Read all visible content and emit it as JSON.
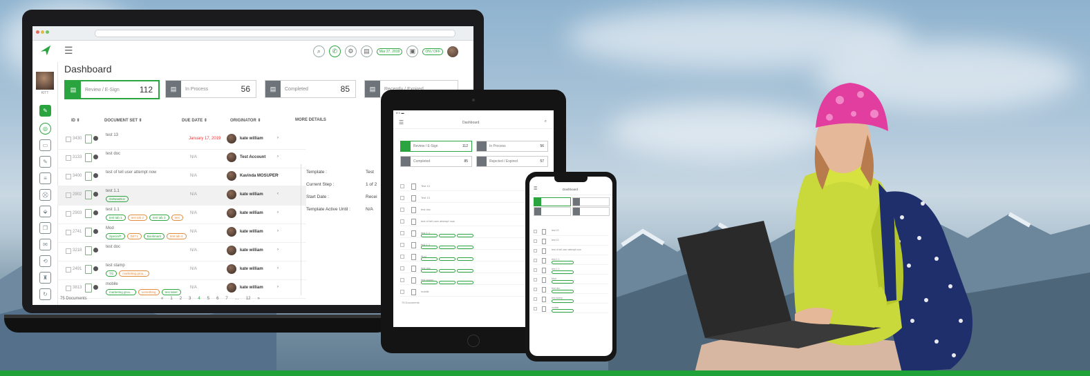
{
  "laptop_app": {
    "title": "Dashboard",
    "side_user_caption": "KITT",
    "top_pills": [
      "Mar 27, 2019",
      "ON / OFF"
    ],
    "cards": [
      {
        "label": "Review / E-Sign",
        "count": "112",
        "active": true
      },
      {
        "label": "In Process",
        "count": "56",
        "active": false
      },
      {
        "label": "Completed",
        "count": "85",
        "active": false
      },
      {
        "label": "Recently / Expired",
        "count": "",
        "active": false
      }
    ],
    "columns": {
      "id": "ID ⇕",
      "document_set": "DOCUMENT SET ⇕",
      "due_date": "DUE DATE ⇕",
      "originator": "ORIGINATOR ⇕",
      "more_details": "MORE DETAILS"
    },
    "rows": [
      {
        "id": "3430",
        "name": "test 13",
        "tags": [],
        "due": "January 17, 2019",
        "due_red": true,
        "originator": "kate william",
        "chev": "›"
      },
      {
        "id": "3133",
        "name": "test doc",
        "tags": [],
        "due": "N/A",
        "due_red": false,
        "originator": "Test Account",
        "chev": "›"
      },
      {
        "id": "3400",
        "name": "test of tell user attempt now",
        "tags": [],
        "due": "N/A",
        "due_red": false,
        "originator": "Kavinda MOSUPER",
        "chev": "›"
      },
      {
        "id": "2902",
        "name": "test 1.1",
        "tags": [
          "GeNewDoc"
        ],
        "due": "N/A",
        "due_red": false,
        "originator": "kate william",
        "chev": "‹"
      },
      {
        "id": "2903",
        "name": "test 1.1",
        "tags": [
          "test tab 1",
          "test tab 2",
          "test tab 3",
          "test"
        ],
        "due": "N/A",
        "due_red": false,
        "originator": "kate william",
        "chev": "›"
      },
      {
        "id": "2741",
        "name": "Mod",
        "tags": [
          "SpecialT",
          "SET1",
          "Bookmark",
          "test tab 4"
        ],
        "due": "N/A",
        "due_red": false,
        "originator": "kate william",
        "chev": "›"
      },
      {
        "id": "3218",
        "name": "test doc",
        "tags": [],
        "due": "N/A",
        "due_red": false,
        "originator": "kate william",
        "chev": "›"
      },
      {
        "id": "2491",
        "name": "test stamp",
        "tags": [
          "TG",
          "marketing grou..."
        ],
        "due": "N/A",
        "due_red": false,
        "originator": "kate william",
        "chev": "›"
      },
      {
        "id": "3813",
        "name": "mobile",
        "tags": [
          "marketing grou...",
          "something",
          "test label"
        ],
        "due": "N/A",
        "due_red": false,
        "originator": "kate william",
        "chev": "›"
      }
    ],
    "details": {
      "template_label": "Template :",
      "template_value": "Test",
      "current_step_label": "Current Step :",
      "current_step_value": "1 of 2",
      "start_date_label": "Start Date :",
      "start_date_value": "Recei",
      "active_until_label": "Template Active Until :",
      "active_until_value": "N/A"
    },
    "pager": {
      "records": "75 Documents",
      "pages": [
        "«",
        "1",
        "2",
        "3",
        "4",
        "5",
        "6",
        "7",
        "…",
        "12",
        "»"
      ]
    }
  },
  "tablet_app": {
    "nav_title": "Dashboard",
    "cards": [
      {
        "label": "Review / E-Sign",
        "count": "112",
        "active": true
      },
      {
        "label": "In Process",
        "count": "56",
        "active": false
      },
      {
        "label": "Completed",
        "count": "85",
        "active": false
      },
      {
        "label": "Rejected / Expired",
        "count": "57",
        "active": false
      }
    ],
    "rows": [
      "Test 13",
      "Test 13",
      "test doc",
      "test of tell user attempt now",
      "test 1.1",
      "test 1.1",
      "Mod",
      "test doc",
      "test stamp",
      "mobile"
    ],
    "footer": "75 Documents"
  },
  "phone_app": {
    "nav_title": "Dashboard",
    "rows": [
      "test 13",
      "test 13",
      "test of tell user attempt now",
      "test 1.1",
      "test 1.1",
      "Mod",
      "test doc",
      "test stamp",
      "mobile"
    ]
  },
  "colors": {
    "accent": "#2aa43e",
    "bar": "#1fa339"
  }
}
